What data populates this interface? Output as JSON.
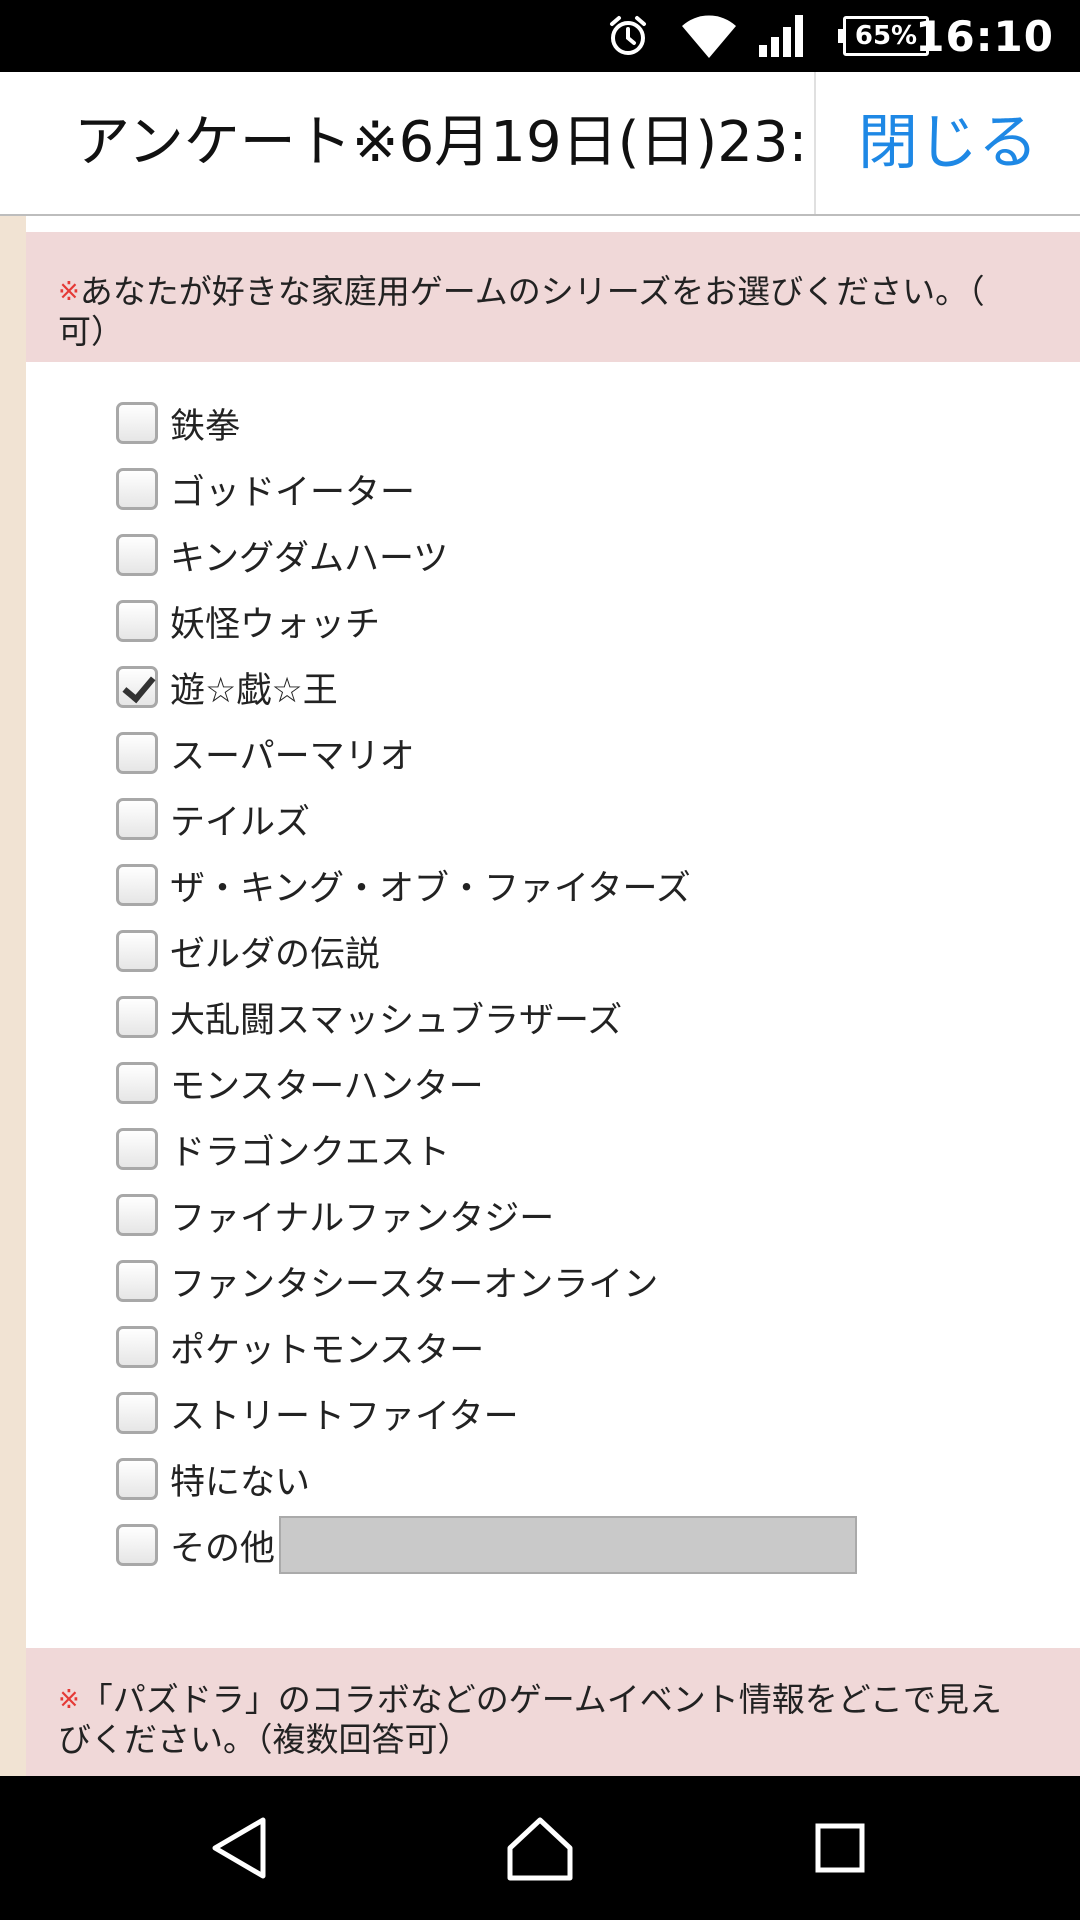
{
  "status_bar": {
    "battery": "65%",
    "time": "16:10",
    "icons": [
      "alarm-icon",
      "wifi-icon",
      "signal-icon",
      "battery-icon"
    ]
  },
  "title_bar": {
    "title": "アンケート※6月19日(日)23:",
    "close_label": "閉じる",
    "close_color": "#1e88e5"
  },
  "question1": {
    "required_mark": "※",
    "line1": "あなたが好きな家庭用ゲームのシリーズをお選びください。（",
    "line2": "可）",
    "options": [
      {
        "label": "鉄拳",
        "checked": false
      },
      {
        "label": "ゴッドイーター",
        "checked": false
      },
      {
        "label": "キングダムハーツ",
        "checked": false
      },
      {
        "label": "妖怪ウォッチ",
        "checked": false
      },
      {
        "label": "遊☆戯☆王",
        "checked": true
      },
      {
        "label": "スーパーマリオ",
        "checked": false
      },
      {
        "label": "テイルズ",
        "checked": false
      },
      {
        "label": "ザ・キング・オブ・ファイターズ",
        "checked": false
      },
      {
        "label": "ゼルダの伝説",
        "checked": false
      },
      {
        "label": "大乱闘スマッシュブラザーズ",
        "checked": false
      },
      {
        "label": "モンスターハンター",
        "checked": false
      },
      {
        "label": "ドラゴンクエスト",
        "checked": false
      },
      {
        "label": "ファイナルファンタジー",
        "checked": false
      },
      {
        "label": "ファンタシースターオンライン",
        "checked": false
      },
      {
        "label": "ポケットモンスター",
        "checked": false
      },
      {
        "label": "ストリートファイター",
        "checked": false
      },
      {
        "label": "特にない",
        "checked": false
      },
      {
        "label": "その他",
        "checked": false,
        "has_text_input": true
      }
    ]
  },
  "question2": {
    "required_mark": "※",
    "line1": "「パズドラ」のコラボなどのゲームイベント情報をどこで見え",
    "line2": "びください。（複数回答可）"
  },
  "nav_bar": {
    "icons": [
      "back-icon",
      "home-icon",
      "recent-apps-icon"
    ]
  }
}
